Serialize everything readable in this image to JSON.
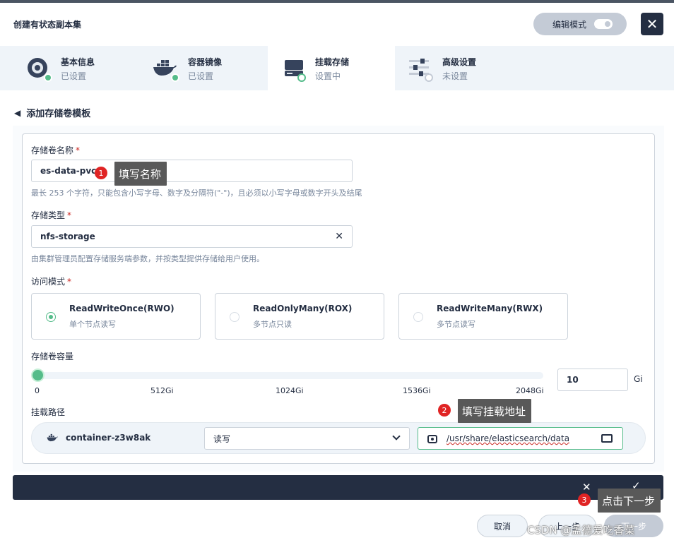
{
  "header": {
    "title": "创建有状态副本集",
    "edit_mode_label": "编辑模式"
  },
  "steps": [
    {
      "name": "基本信息",
      "status": "已设置"
    },
    {
      "name": "容器镜像",
      "status": "已设置"
    },
    {
      "name": "挂载存储",
      "status": "设置中"
    },
    {
      "name": "高级设置",
      "status": "未设置"
    }
  ],
  "back_label": "添加存储卷模板",
  "form": {
    "volume_name_label": "存储卷名称",
    "volume_name_value": "es-data-pvc",
    "volume_name_hint": "最长 253 个字符，只能包含小写字母、数字及分隔符(\"-\")，且必须以小写字母或数字开头及结尾",
    "storage_type_label": "存储类型",
    "storage_type_value": "nfs-storage",
    "storage_type_hint": "由集群管理员配置存储服务端参数，并按类型提供存储给用户使用。",
    "access_mode_label": "访问模式",
    "access_modes": [
      {
        "title": "ReadWriteOnce(RWO)",
        "desc": "单个节点读写",
        "selected": true
      },
      {
        "title": "ReadOnlyMany(ROX)",
        "desc": "多节点只读",
        "selected": false
      },
      {
        "title": "ReadWriteMany(RWX)",
        "desc": "多节点读写",
        "selected": false
      }
    ],
    "capacity_label": "存储卷容量",
    "capacity_ticks": [
      "0",
      "512Gi",
      "1024Gi",
      "1536Gi",
      "2048Gi"
    ],
    "capacity_value": "10",
    "capacity_unit": "Gi",
    "capacity_fraction": 0.005,
    "mount_path_label": "挂载路径",
    "mount": {
      "container": "container-z3w8ak",
      "mode": "读写",
      "path": "/usr/share/elasticsearch/data"
    }
  },
  "footer": {
    "cancel": "取消",
    "prev": "上一步",
    "next": "下一步"
  },
  "annotations": [
    {
      "num": "1",
      "text": "填写名称"
    },
    {
      "num": "2",
      "text": "填写挂载地址"
    },
    {
      "num": "3",
      "text": "点击下一步"
    }
  ],
  "watermark": "CSDN @孟德爱吃香菜",
  "colors": {
    "accent": "#55bc8a",
    "dark": "#242e42",
    "annotation_badge": "#e02424"
  }
}
